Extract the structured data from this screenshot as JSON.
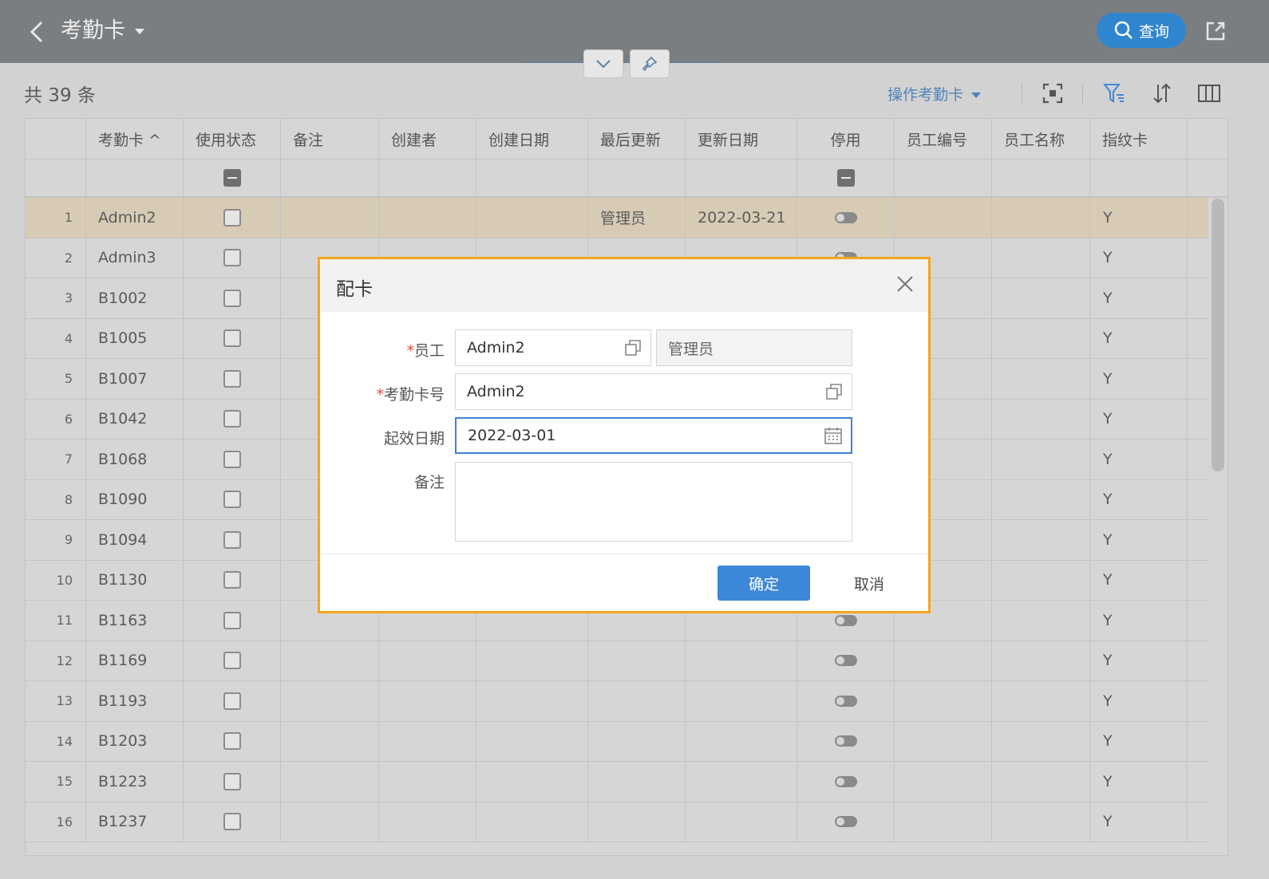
{
  "header": {
    "title": "考勤卡",
    "query_label": "查询"
  },
  "toolbar": {
    "count": "共 39 条",
    "ops_label": "操作考勤卡"
  },
  "table": {
    "columns": [
      "考勤卡 ^",
      "使用状态",
      "备注",
      "创建者",
      "创建日期",
      "最后更新",
      "更新日期",
      "停用",
      "员工编号",
      "员工名称",
      "指纹卡"
    ],
    "rows": [
      {
        "n": "1",
        "card": "Admin2",
        "updater": "管理员",
        "update_date": "2022-03-21",
        "fp": "Y"
      },
      {
        "n": "2",
        "card": "Admin3",
        "fp": "Y"
      },
      {
        "n": "3",
        "card": "B1002",
        "fp": "Y"
      },
      {
        "n": "4",
        "card": "B1005",
        "fp": "Y"
      },
      {
        "n": "5",
        "card": "B1007",
        "fp": "Y"
      },
      {
        "n": "6",
        "card": "B1042",
        "fp": "Y"
      },
      {
        "n": "7",
        "card": "B1068",
        "fp": "Y"
      },
      {
        "n": "8",
        "card": "B1090",
        "fp": "Y"
      },
      {
        "n": "9",
        "card": "B1094",
        "fp": "Y"
      },
      {
        "n": "10",
        "card": "B1130",
        "fp": "Y"
      },
      {
        "n": "11",
        "card": "B1163",
        "fp": "Y"
      },
      {
        "n": "12",
        "card": "B1169",
        "fp": "Y"
      },
      {
        "n": "13",
        "card": "B1193",
        "fp": "Y"
      },
      {
        "n": "14",
        "card": "B1203",
        "fp": "Y"
      },
      {
        "n": "15",
        "card": "B1223",
        "fp": "Y"
      },
      {
        "n": "16",
        "card": "B1237",
        "fp": "Y"
      }
    ]
  },
  "dialog": {
    "title": "配卡",
    "required_mark": "*",
    "employee_label": "员工",
    "employee_value": "Admin2",
    "employee_name": "管理员",
    "card_label": "考勤卡号",
    "card_value": "Admin2",
    "date_label": "起效日期",
    "date_value": "2022-03-01",
    "note_label": "备注",
    "note_value": "",
    "ok_label": "确定",
    "cancel_label": "取消"
  },
  "colors": {
    "accent": "#3d87d8",
    "highlight_border": "#f4a51c",
    "selected_row": "#d8cbb5"
  }
}
